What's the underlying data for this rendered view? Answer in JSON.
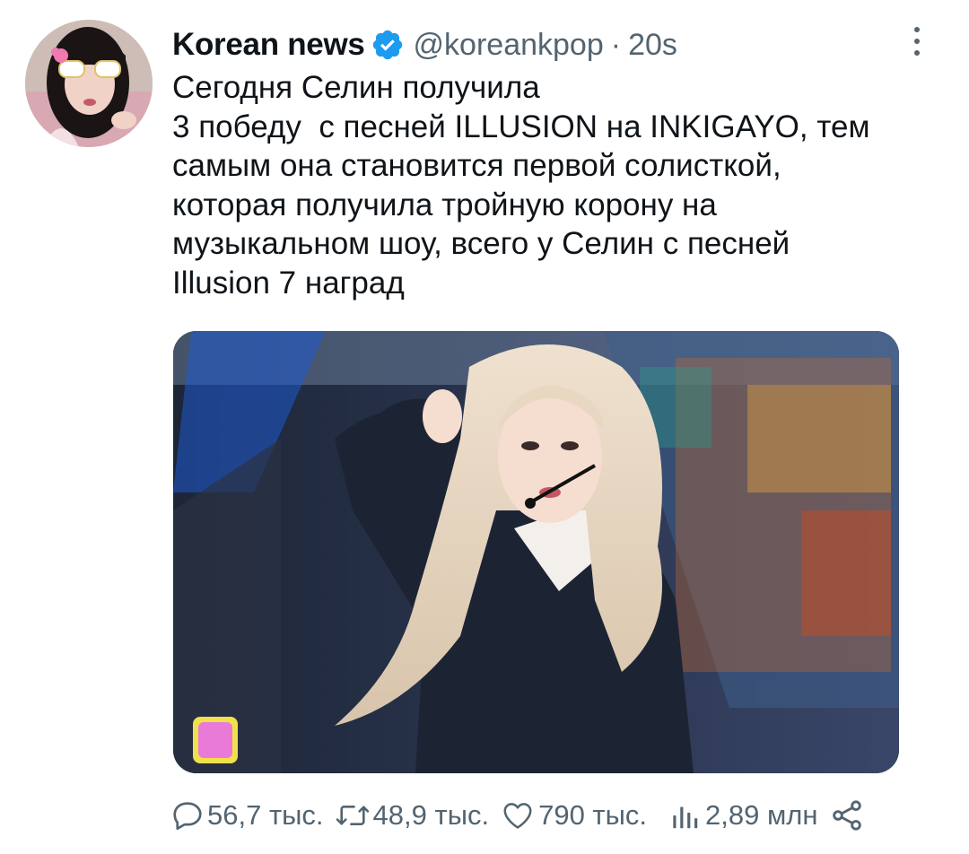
{
  "author": {
    "display_name": "Korean news",
    "handle": "@koreankpop",
    "separator": "·",
    "time": "20s",
    "verified": true
  },
  "tweet": {
    "lines": [
      "Сегодня Селин получила",
      "3 победу  с песней ILLUSION на INKIGAYO, тем",
      "самым она становится первой солисткой,",
      "которая получила тройную корону на",
      "музыкальном шоу, всего у Селин с песней",
      "Illusion 7 наград"
    ]
  },
  "actions": {
    "replies": "56,7 тыс.",
    "retweets": "48,9 тыс.",
    "likes": "790 тыс.",
    "views": "2,89 млн"
  },
  "icons": {
    "more": "more-vertical-icon",
    "verified": "verified-badge-icon",
    "reply": "reply-icon",
    "retweet": "retweet-icon",
    "like": "heart-icon",
    "views": "views-bar-chart-icon",
    "share": "share-icon"
  },
  "colors": {
    "text": "#0f1419",
    "secondary": "#536471",
    "verified": "#1d9bf0"
  }
}
